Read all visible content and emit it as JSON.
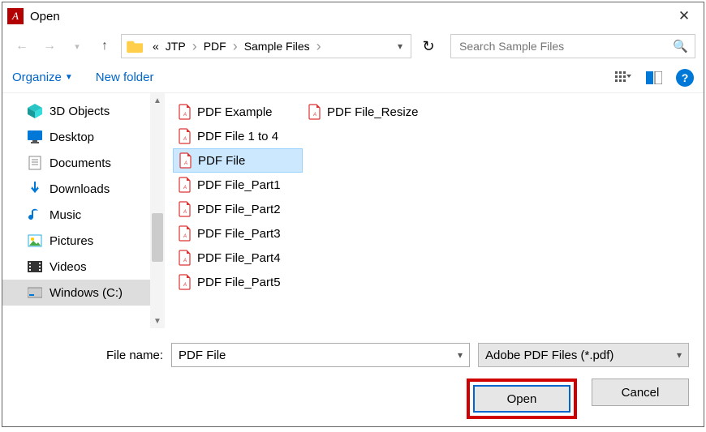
{
  "window": {
    "title": "Open"
  },
  "breadcrumb": {
    "segments": [
      "JTP",
      "PDF",
      "Sample Files"
    ]
  },
  "search": {
    "placeholder": "Search Sample Files"
  },
  "toolbar": {
    "organize": "Organize",
    "new_folder": "New folder"
  },
  "sidebar": {
    "items": [
      {
        "label": "3D Objects",
        "icon": "cube"
      },
      {
        "label": "Desktop",
        "icon": "desktop"
      },
      {
        "label": "Documents",
        "icon": "doc"
      },
      {
        "label": "Downloads",
        "icon": "download"
      },
      {
        "label": "Music",
        "icon": "music"
      },
      {
        "label": "Pictures",
        "icon": "pictures"
      },
      {
        "label": "Videos",
        "icon": "videos"
      },
      {
        "label": "Windows (C:)",
        "icon": "drive",
        "selected": true
      }
    ]
  },
  "files": {
    "items": [
      {
        "label": "PDF Example"
      },
      {
        "label": "PDF File 1 to 4"
      },
      {
        "label": "PDF File",
        "selected": true
      },
      {
        "label": "PDF File_Part1"
      },
      {
        "label": "PDF File_Part2"
      },
      {
        "label": "PDF File_Part3"
      },
      {
        "label": "PDF File_Part4"
      },
      {
        "label": "PDF File_Part5"
      },
      {
        "label": "PDF File_Resize"
      }
    ]
  },
  "footer": {
    "filename_label": "File name:",
    "filename_value": "PDF File",
    "filter": "Adobe PDF Files (*.pdf)",
    "open": "Open",
    "cancel": "Cancel"
  }
}
